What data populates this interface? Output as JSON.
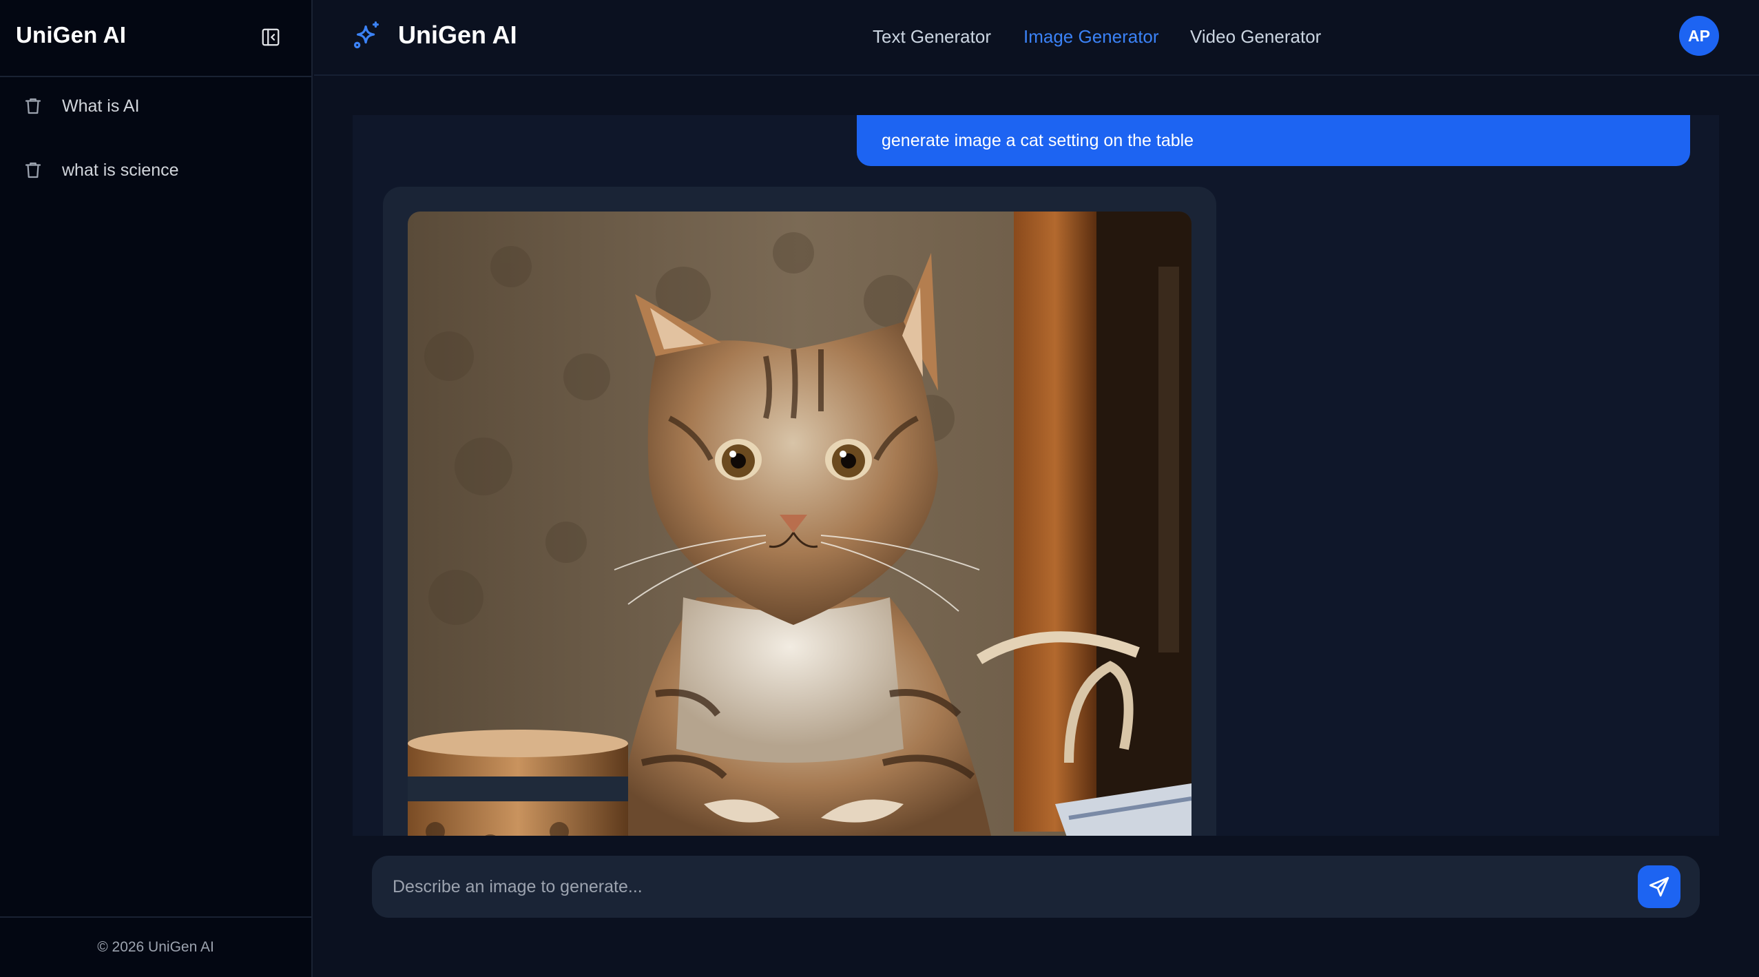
{
  "sidebar": {
    "title": "UniGen AI",
    "collapse_icon": "sidebar-collapse-icon",
    "items": [
      {
        "label": "What is AI",
        "icons": [
          "chat-bubble-icon",
          "trash-icon"
        ]
      },
      {
        "label": "what is science",
        "icons": [
          "chat-bubble-icon",
          "trash-icon"
        ]
      }
    ],
    "footer": "© 2026 UniGen AI"
  },
  "header": {
    "brand_icon": "sparkles-icon",
    "title": "UniGen AI",
    "tabs": [
      {
        "label": "Text Generator",
        "active": false
      },
      {
        "label": "Image Generator",
        "active": true
      },
      {
        "label": "Video Generator",
        "active": false
      }
    ],
    "avatar_initials": "AP"
  },
  "chat": {
    "user_message": "generate image a cat setting on the table",
    "generated_image": "tabby cat sitting at a wooden table beside a ceramic cup"
  },
  "composer": {
    "placeholder": "Describe an image to generate...",
    "value": "",
    "send_icon": "paper-plane-send-icon"
  },
  "colors": {
    "accent": "#1d64f2",
    "active_tab": "#3b82f6",
    "background": "#0b1120",
    "sidebar": "#030712",
    "panel": "#0f172a",
    "card": "#1a2436"
  }
}
